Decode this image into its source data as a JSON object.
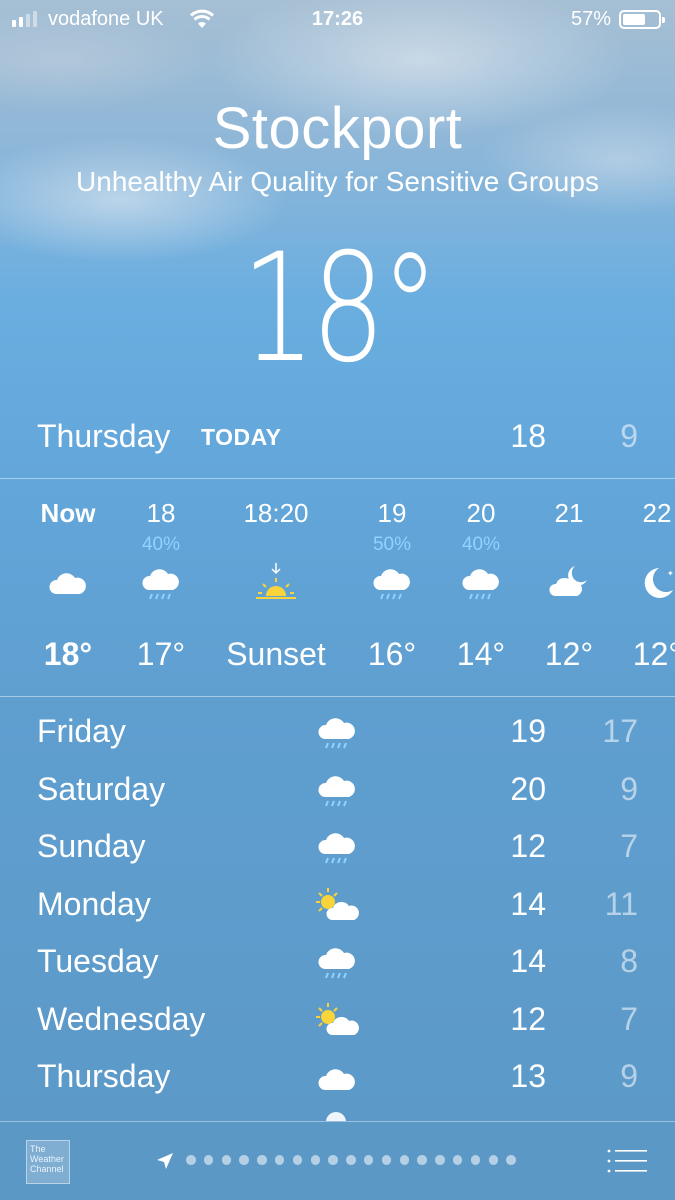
{
  "status_bar": {
    "carrier": "vodafone UK",
    "time": "17:26",
    "battery_percent": "57%",
    "battery_level": 0.57,
    "signal_bars": 2,
    "signal_max": 4
  },
  "header": {
    "city": "Stockport",
    "condition": "Unhealthy Air Quality for Sensitive Groups",
    "current_temp": "18°"
  },
  "today": {
    "day": "Thursday",
    "label": "TODAY",
    "high": "18",
    "low": "9"
  },
  "hourly": [
    {
      "time": "Now",
      "pop": "",
      "icon": "cloud-icon",
      "temp": "18°"
    },
    {
      "time": "18",
      "pop": "40%",
      "icon": "rain-cloud-icon",
      "temp": "17°"
    },
    {
      "time": "18:20",
      "pop": "",
      "icon": "sunset-icon",
      "temp": "Sunset"
    },
    {
      "time": "19",
      "pop": "50%",
      "icon": "rain-cloud-icon",
      "temp": "16°"
    },
    {
      "time": "20",
      "pop": "40%",
      "icon": "rain-cloud-icon",
      "temp": "14°"
    },
    {
      "time": "21",
      "pop": "",
      "icon": "cloudy-night-icon",
      "temp": "12°"
    },
    {
      "time": "22",
      "pop": "",
      "icon": "moon-icon",
      "temp": "12°"
    }
  ],
  "daily": [
    {
      "day": "Friday",
      "icon": "rain-cloud-icon",
      "high": "19",
      "low": "17"
    },
    {
      "day": "Saturday",
      "icon": "rain-cloud-icon",
      "high": "20",
      "low": "9"
    },
    {
      "day": "Sunday",
      "icon": "rain-cloud-icon",
      "high": "12",
      "low": "7"
    },
    {
      "day": "Monday",
      "icon": "partly-sunny-icon",
      "high": "14",
      "low": "11"
    },
    {
      "day": "Tuesday",
      "icon": "rain-cloud-icon",
      "high": "14",
      "low": "8"
    },
    {
      "day": "Wednesday",
      "icon": "partly-sunny-icon",
      "high": "12",
      "low": "7"
    },
    {
      "day": "Thursday",
      "icon": "cloud-icon",
      "high": "13",
      "low": "9"
    }
  ],
  "footer": {
    "logo_text": "The Weather Channel",
    "page_count": 19
  },
  "colors": {
    "sky_blue": "#63a6da",
    "pop_blue": "#8fd3ff",
    "sun_yellow": "#f8d43a"
  }
}
